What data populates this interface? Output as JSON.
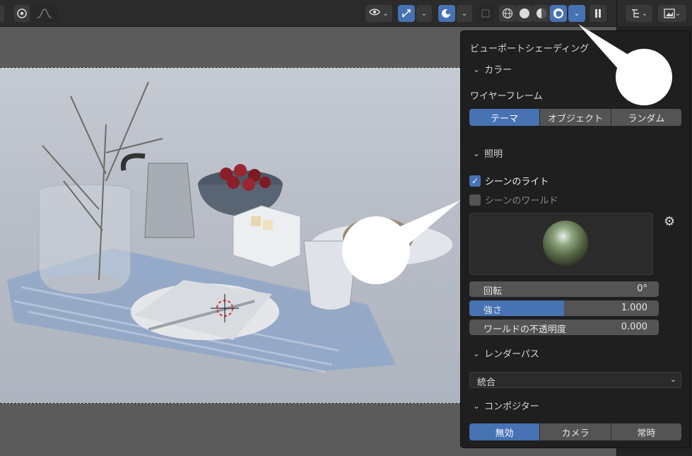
{
  "header": {
    "solid_mode_icon": "circle-dot-icon",
    "curve_icon": "curve-icon",
    "visibility_icon": "eye-icon",
    "gizmo_icon": "gizmo-icon",
    "overlay_icon": "overlay-icon",
    "xray_icon": "xray-icon",
    "shading_modes": [
      "wireframe-icon",
      "solid-icon",
      "material-icon",
      "rendered-icon"
    ],
    "pause_icon": "pause-icon",
    "outliner_icon": "outliner-icon",
    "image_icon": "image-icon"
  },
  "popover": {
    "title": "ビューポートシェーディング",
    "color_section": "カラー",
    "wireframe_label": "ワイヤーフレーム",
    "wireframe_options": [
      "テーマ",
      "オブジェクト",
      "ランダム"
    ],
    "wireframe_selected": "テーマ",
    "lighting_section": "照明",
    "scene_lights_label": "シーンのライト",
    "scene_lights_checked": true,
    "scene_world_label": "シーンのワールド",
    "scene_world_checked": false,
    "rotation_label": "回転",
    "rotation_value": "0°",
    "strength_label": "強さ",
    "strength_value": "1.000",
    "strength_fill": 0.5,
    "world_opacity_label": "ワールドの不透明度",
    "world_opacity_value": "0.000",
    "render_pass_section": "レンダーパス",
    "render_pass_value": "統合",
    "compositor_section": "コンポジター",
    "compositor_options": [
      "無効",
      "カメラ",
      "常時"
    ],
    "compositor_selected": "無効"
  },
  "colors": {
    "accent": "#4772b3",
    "panel": "#1f1f1f",
    "field": "#545454"
  }
}
